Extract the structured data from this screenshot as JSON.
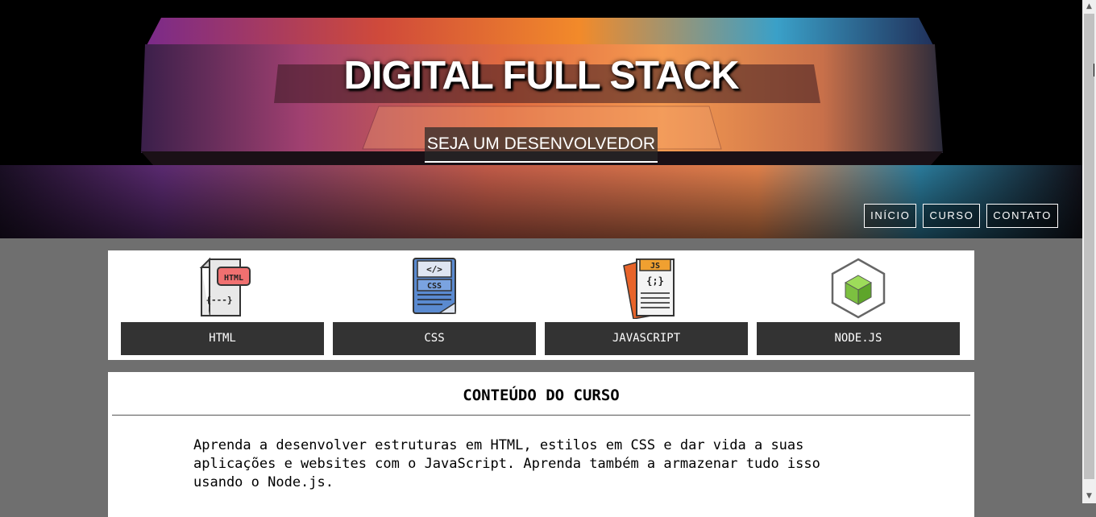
{
  "hero": {
    "title": "DIGITAL FULL STACK",
    "subtitle": "SEJA UM DESENVOLVEDOR"
  },
  "nav": {
    "items": [
      {
        "label": "INÍCIO"
      },
      {
        "label": "CURSO"
      },
      {
        "label": "CONTATO"
      }
    ]
  },
  "technologies": [
    {
      "label": "HTML",
      "icon": "html-file-icon",
      "icon_text": "HTML",
      "icon_code": "{---}"
    },
    {
      "label": "CSS",
      "icon": "css-file-icon",
      "icon_text": "CSS",
      "icon_code": "</>"
    },
    {
      "label": "JAVASCRIPT",
      "icon": "js-file-icon",
      "icon_text": "JS",
      "icon_code": "{;}"
    },
    {
      "label": "NODE.JS",
      "icon": "nodejs-cube-icon"
    }
  ],
  "content": {
    "title": "CONTEÚDO DO CURSO",
    "line1": "Aprenda a desenvolver estruturas em HTML, estilos em CSS e dar vida a suas",
    "line2": "aplicações e websites com o JavaScript. Aprenda também a armazenar tudo isso",
    "line3": "usando o Node.js."
  },
  "colors": {
    "page_background": "#6f6f6f",
    "button_background": "#333333",
    "panel_background": "#ffffff"
  }
}
